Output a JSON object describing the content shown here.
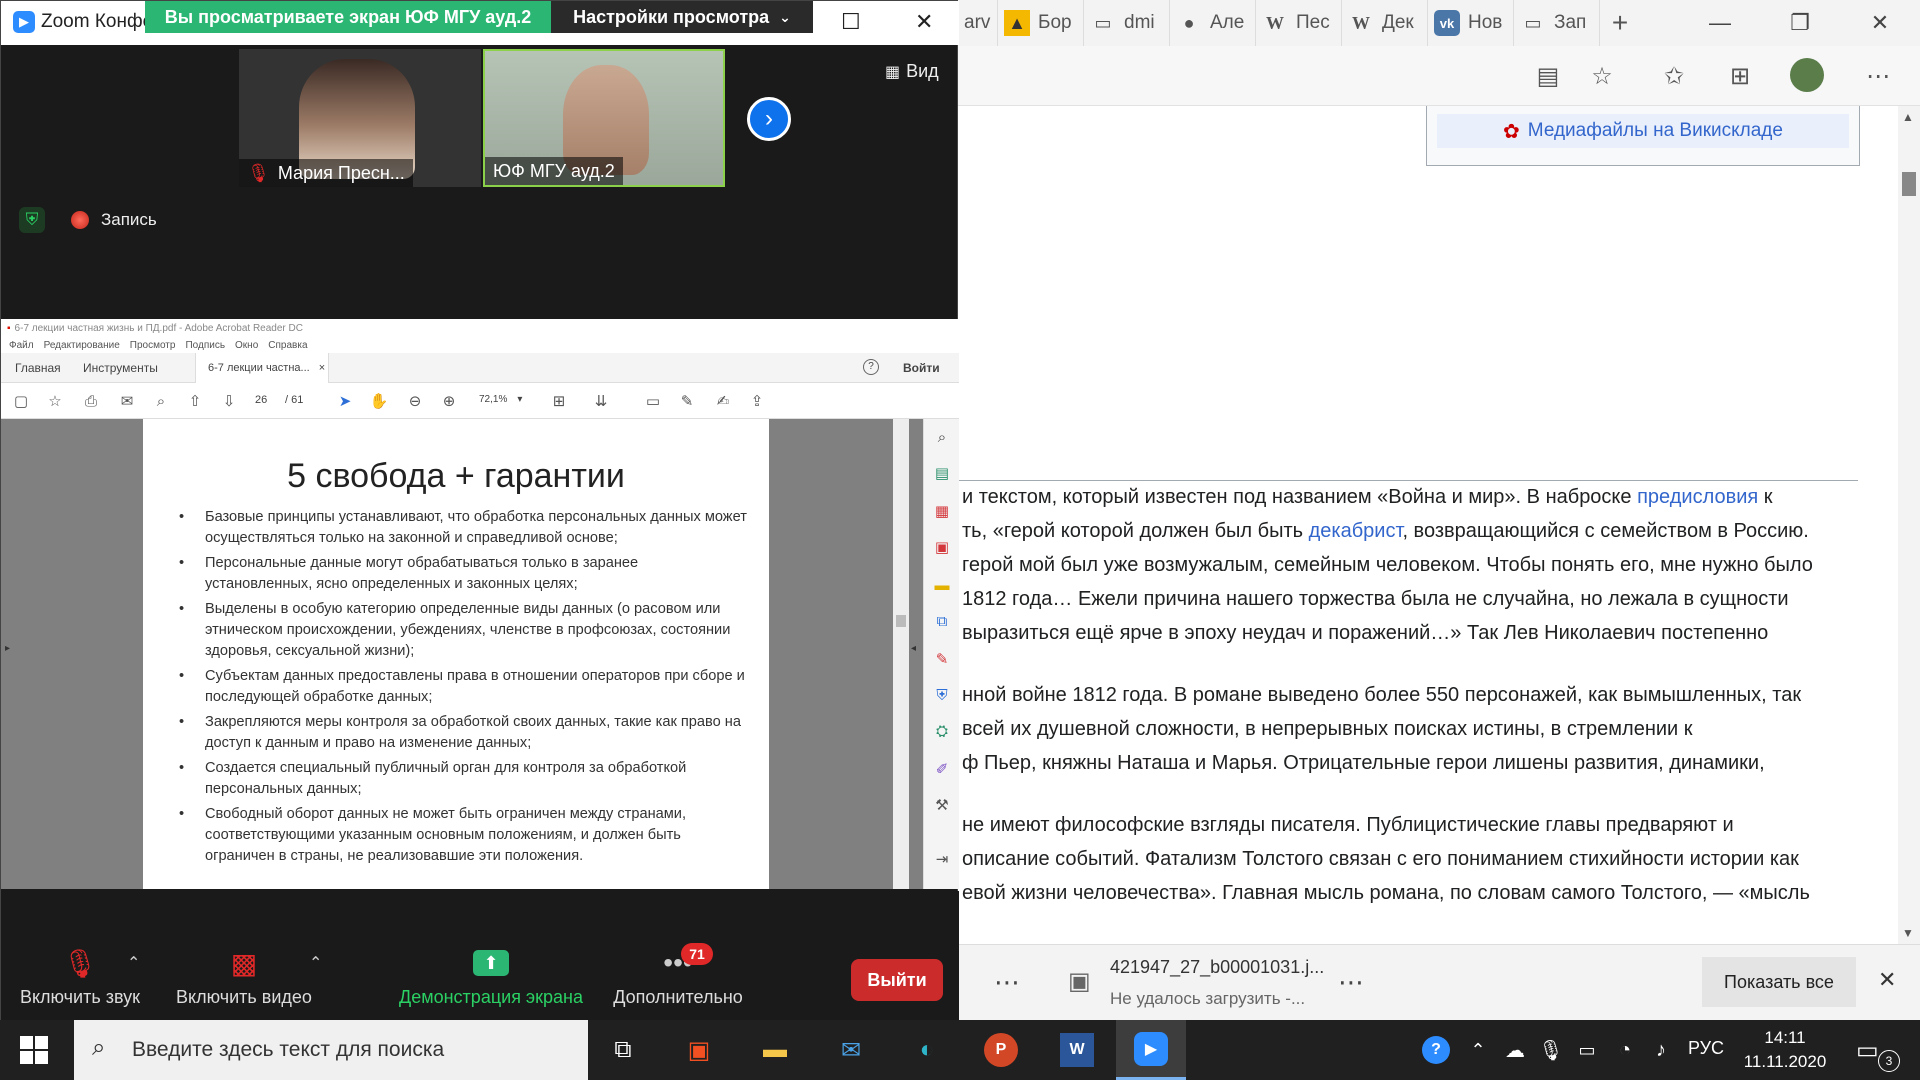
{
  "edge": {
    "tabs": [
      {
        "icon": "image-icon",
        "label": "Бор"
      },
      {
        "icon": "document-icon",
        "label": "dmi"
      },
      {
        "icon": "person-icon",
        "label": "Але"
      },
      {
        "icon": "wikipedia-icon",
        "label": "Пес"
      },
      {
        "icon": "wikipedia-icon",
        "label": "Дек"
      },
      {
        "icon": "vk-icon",
        "label": "Нов"
      },
      {
        "icon": "document-icon",
        "label": "Зап"
      }
    ],
    "tab_fragment": "arv",
    "wiki_media_link": "Медиафайлы на Викискладе",
    "article_lines": [
      [
        {
          "t": "и текстом, который известен под названием «Война и мир». В наброске "
        },
        {
          "t": "предисловия",
          "link": true
        },
        {
          "t": " к"
        }
      ],
      [
        {
          "t": "ть, «герой которой должен был быть "
        },
        {
          "t": "декабрист",
          "link": true
        },
        {
          "t": ", возвращающийся с семейством в Россию."
        }
      ],
      [
        {
          "t": "герой мой был уже возмужалым, семейным человеком. Чтобы понять его, мне нужно было"
        }
      ],
      [
        {
          "t": " 1812 года… Ежели причина нашего торжества была не случайна, но лежала в сущности"
        }
      ],
      [
        {
          "t": "выразиться ещё ярче в эпоху неудач и поражений…» Так Лев Николаевич постепенно"
        }
      ],
      [
        {
          "t": "нной войне 1812 года. В романе выведено более 550 персонажей, как вымышленных, так"
        }
      ],
      [
        {
          "t": "всей их душевной сложности, в непрерывных поисках истины, в стремлении к"
        }
      ],
      [
        {
          "t": "ф Пьер, княжны Наташа и Марья. Отрицательные герои лишены развития, динамики,"
        }
      ],
      [
        {
          "t": "не имеют философские взгляды писателя. Публицистические главы предваряют и"
        }
      ],
      [
        {
          "t": "описание событий. Фатализм Толстого связан с его пониманием стихийности истории как"
        }
      ],
      [
        {
          "t": "евой жизни человечества». Главная мысль романа, по словам самого Толстого, — «мысль"
        }
      ]
    ],
    "download": {
      "filename": "421947_27_b00001031.j...",
      "status": "Не удалось загрузить -...",
      "show_all": "Показать все"
    }
  },
  "zoom": {
    "title": "Zoom Конфе",
    "banner": "Вы просматриваете экран ЮФ МГУ ауд.2",
    "view_settings": "Настройки просмотра",
    "view_button": "Вид",
    "participants": [
      {
        "name": "Мария Пресн..."
      },
      {
        "name": "ЮФ МГУ ауд.2"
      }
    ],
    "recording": "Запись",
    "controls": {
      "mute": "Включить звук",
      "video": "Включить видео",
      "share": "Демонстрация экрана",
      "more": "Дополнительно",
      "more_badge": "71",
      "leave": "Выйти"
    }
  },
  "acrobat": {
    "title": "6-7 лекции частная жизнь и ПД.pdf - Adobe Acrobat Reader DC",
    "menu": [
      "Файл",
      "Редактирование",
      "Просмотр",
      "Подпись",
      "Окно",
      "Справка"
    ],
    "tabs": {
      "home": "Главная",
      "tools": "Инструменты",
      "doc": "6-7 лекции частна...",
      "signin": "Войти"
    },
    "page_current": "26",
    "page_total": "/ 61",
    "zoom_level": "72,1%",
    "slide": {
      "title": "5 свобода + гарантии",
      "bullets": [
        "Базовые принципы устанавливают, что обработка персональных данных может осуществляться только на законной и справедливой основе;",
        "Персональные данные могут обрабатываться только в заранее установленных, ясно определенных и законных целях;",
        "Выделены в особую категорию определенные виды данных (о расовом или этническом происхождении, убеждениях, членстве в профсоюзах, состоянии здоровья, сексуальной жизни);",
        "Субъектам данных предоставлены права в отношении операторов при сборе и последующей обработке данных;",
        "Закрепляются меры контроля за обработкой своих данных, такие как право на доступ к данным и право на изменение данных;",
        "Создается специальный публичный орган для контроля за обработкой персональных данных;",
        "Свободный оборот данных не может быть ограничен между странами, соответствующими указанным основным положениям, и должен быть ограничен в страны, не реализовавшие эти положения."
      ]
    }
  },
  "taskbar": {
    "search_placeholder": "Введите здесь текст для поиска",
    "language": "РУС",
    "time": "14:11",
    "date": "11.11.2020",
    "notification_count": "3"
  },
  "colors": {
    "zoom_green": "#2bb673",
    "zoom_red": "#cc2b2b",
    "wiki_link": "#3366cc",
    "taskbar": "#202020"
  }
}
